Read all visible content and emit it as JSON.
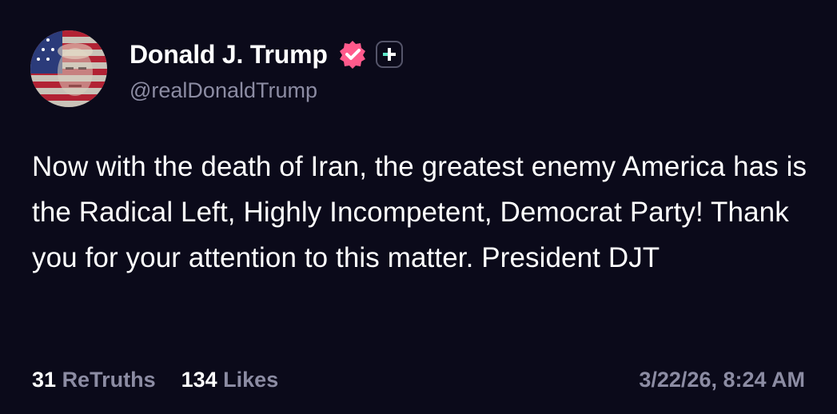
{
  "post": {
    "author": {
      "display_name": "Donald J. Trump",
      "handle": "@realDonaldTrump",
      "verified_icon": "verified-check-badge",
      "plus_icon": "plus-badge"
    },
    "body": "Now with the death of Iran, the greatest enemy America has is the Radical Left, Highly Incompetent, Democrat Party! Thank you for your attention to this matter. President DJT",
    "stats": {
      "retruths_count": "31",
      "retruths_label": "ReTruths",
      "likes_count": "134",
      "likes_label": "Likes"
    },
    "timestamp": "3/22/26, 8:24 AM"
  },
  "colors": {
    "background": "#0b0a1a",
    "text": "#ffffff",
    "muted": "#8c8ca3",
    "verified": "#ff5a8c",
    "plus_accent": "#5ee6c8"
  }
}
